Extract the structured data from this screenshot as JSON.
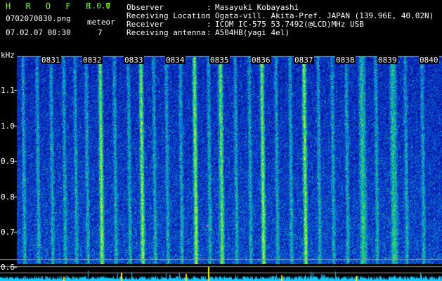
{
  "app": {
    "title": "H R O F F T",
    "version": "1.0.0"
  },
  "file": {
    "name": "0702070830.png",
    "datetime": "07.02.07 08:30"
  },
  "meteor": {
    "label": "meteor",
    "count": "7"
  },
  "info": [
    {
      "label": "Observer",
      "sep": ":",
      "value": "Masayuki Kobayashi"
    },
    {
      "label": "Receiving Location",
      "sep": ":",
      "value": "Ogata-vill. Akita-Pref. JAPAN (139.96E, 40.02N)"
    },
    {
      "label": "Receiver",
      "sep": ":",
      "value": "ICOM IC-575 53.7492(@LCD)MHz USB"
    },
    {
      "label": "Receiving antenna",
      "sep": ":",
      "value": "A504HB(yagi 4el)"
    }
  ],
  "axis": {
    "y_unit": "kHz",
    "y_ticks": [
      "1.1",
      "1.0",
      "0.9",
      "0.8",
      "0.7",
      "0.6"
    ],
    "x_ticks": [
      "0831",
      "0832",
      "0833",
      "0834",
      "0835",
      "0836",
      "0837",
      "0838",
      "0839",
      "0840"
    ]
  }
}
